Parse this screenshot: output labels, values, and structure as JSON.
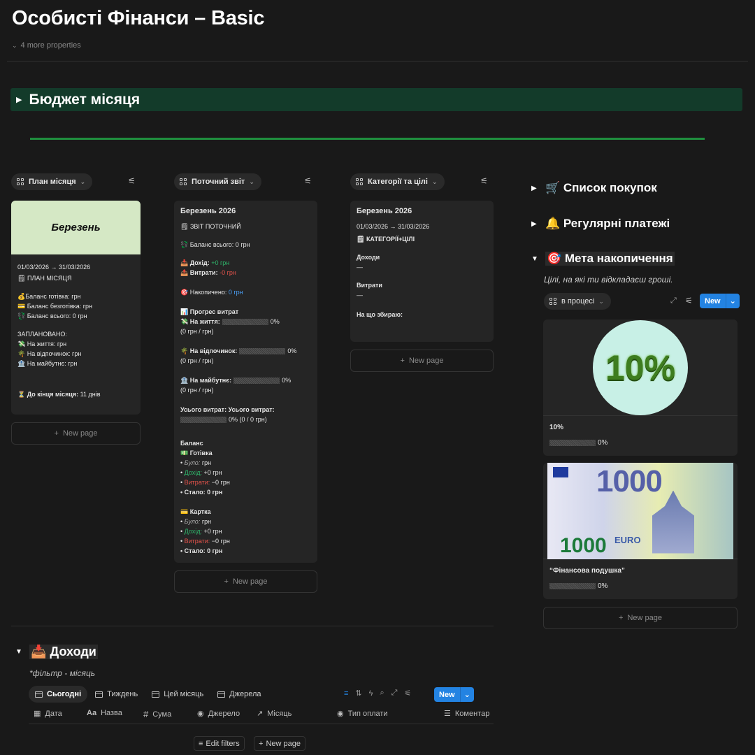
{
  "page": {
    "title": "Особисті Фінанси – Basic",
    "more_properties": "4 more properties"
  },
  "callout": {
    "title": "Бюджет місяця"
  },
  "views": {
    "plan": "План місяця",
    "current": "Поточний звіт",
    "categories": "Категорії та цілі"
  },
  "plan_card": {
    "cover_title": "Березень",
    "date": "01/03/2026 → 31/03/2026",
    "header": "ПЛАН МІСЯЦЯ",
    "lines": [
      "💰Баланс готівка:  грн",
      "💳 Баланс безготівка:  грн",
      "💱 Баланс всього: 0 грн"
    ],
    "planned_label": "ЗАПЛАНОВАНО:",
    "planned": [
      "💸 На життя:  грн",
      "🌴 На відпочинок:  грн",
      "🏦 На майбутнє:  грн"
    ],
    "countdown_label": "⏳ До кінця місяця:",
    "countdown_value": "11 днів"
  },
  "report_card": {
    "title": "Березень 2026",
    "header": "ЗВІТ ПОТОЧНИЙ",
    "balance_total": "💱 Баланс всього: 0 грн",
    "income_label": "📥 Дохід:",
    "income_value": "+0 грн",
    "expense_label": "📤 Витрати:",
    "expense_value": "-0 грн",
    "saved_label": "🎯 Накопичено:",
    "saved_value": "0 грн",
    "progress_label": "📊 Прогрес витрат",
    "life_label": "💸 На життя:",
    "life_pct": "0%",
    "life_sub": "(0 грн /  грн)",
    "rest_label": "🌴 На відпочинок:",
    "rest_pct": "0%",
    "rest_sub": "(0 грн /  грн)",
    "future_label": "🏦 На майбутнє:",
    "future_pct": "0%",
    "future_sub": "(0 грн /  грн)",
    "total_label": "Усього витрат: Усього витрат:",
    "total_pct": "0%  (0 / 0 грн)",
    "balance_label": "Баланс",
    "cash_label": "💵 Готівка",
    "card_label": "💳 Картка",
    "was": "Було:",
    "was_val": "грн",
    "inc": "Дохід:",
    "inc_val": "+0 грн",
    "exp": "Витрати:",
    "exp_val": "−0 грн",
    "became": "Стало: 0 грн"
  },
  "cat_card": {
    "title": "Березень 2026",
    "date": "01/03/2026 → 31/03/2026",
    "header": "КАТЕГОРІЇ+ЦІЛІ",
    "income": "Доходи",
    "expenses": "Витрати",
    "dash": "—",
    "saving": "На що збираю:"
  },
  "new_page": "New page",
  "right": {
    "shopping": "🛒 Список покупок",
    "payments": "🔔 Регулярні платежі",
    "goal": "🎯 Мета накопичення",
    "goal_desc": "Цілі, на які ти відкладаєш гроші.",
    "filter": "в процесі",
    "new": "New",
    "goal1_name": "10%",
    "goal1_pct": "0%",
    "goal1_image_text": "10%",
    "goal2_name": "“Фінансова подушка”",
    "goal2_pct": "0%",
    "goal2_image_text": "1000",
    "goal2_euro": "EURO"
  },
  "income": {
    "title": "📥 Доходи",
    "subtitle": "*фільтр - місяць",
    "tabs": [
      "Сьогодні",
      "Тиждень",
      "Цей місяць",
      "Джерела"
    ],
    "new": "New",
    "columns": [
      "Дата",
      "Назва",
      "Сума",
      "Джерело",
      "Місяць",
      "Тип оплати",
      "Коментар"
    ],
    "edit_filters": "Edit filters",
    "new_page": "New page"
  }
}
